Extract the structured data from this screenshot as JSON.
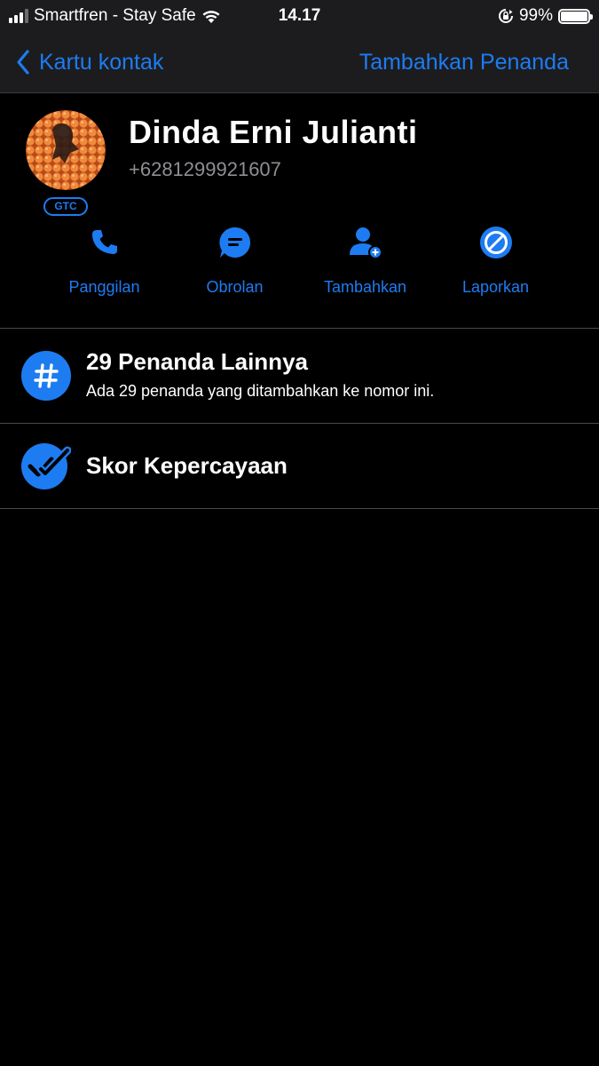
{
  "status_bar": {
    "carrier": "Smartfren - Stay Safe",
    "time": "14.17",
    "battery_text": "99%"
  },
  "nav": {
    "back_label": "Kartu kontak",
    "action_label": "Tambahkan Penanda"
  },
  "contact": {
    "name": "Dinda Erni Julianti",
    "phone": "+6281299921607",
    "badge": "GTC"
  },
  "actions": [
    {
      "label": "Panggilan",
      "icon": "phone-icon"
    },
    {
      "label": "Obrolan",
      "icon": "chat-icon"
    },
    {
      "label": "Tambahkan",
      "icon": "add-user-icon"
    },
    {
      "label": "Laporkan",
      "icon": "block-icon"
    }
  ],
  "rows": {
    "tags": {
      "title": "29 Penanda Lainnya",
      "subtitle": "Ada 29 penanda yang ditambahkan ke nomor ini.",
      "icon": "hashtag-icon"
    },
    "trust": {
      "title": "Skor Kepercayaan",
      "icon": "double-check-icon"
    }
  },
  "colors": {
    "accent": "#1d7cf2",
    "background": "#000000",
    "bar": "#1c1c1e",
    "muted": "#8e8e93"
  }
}
